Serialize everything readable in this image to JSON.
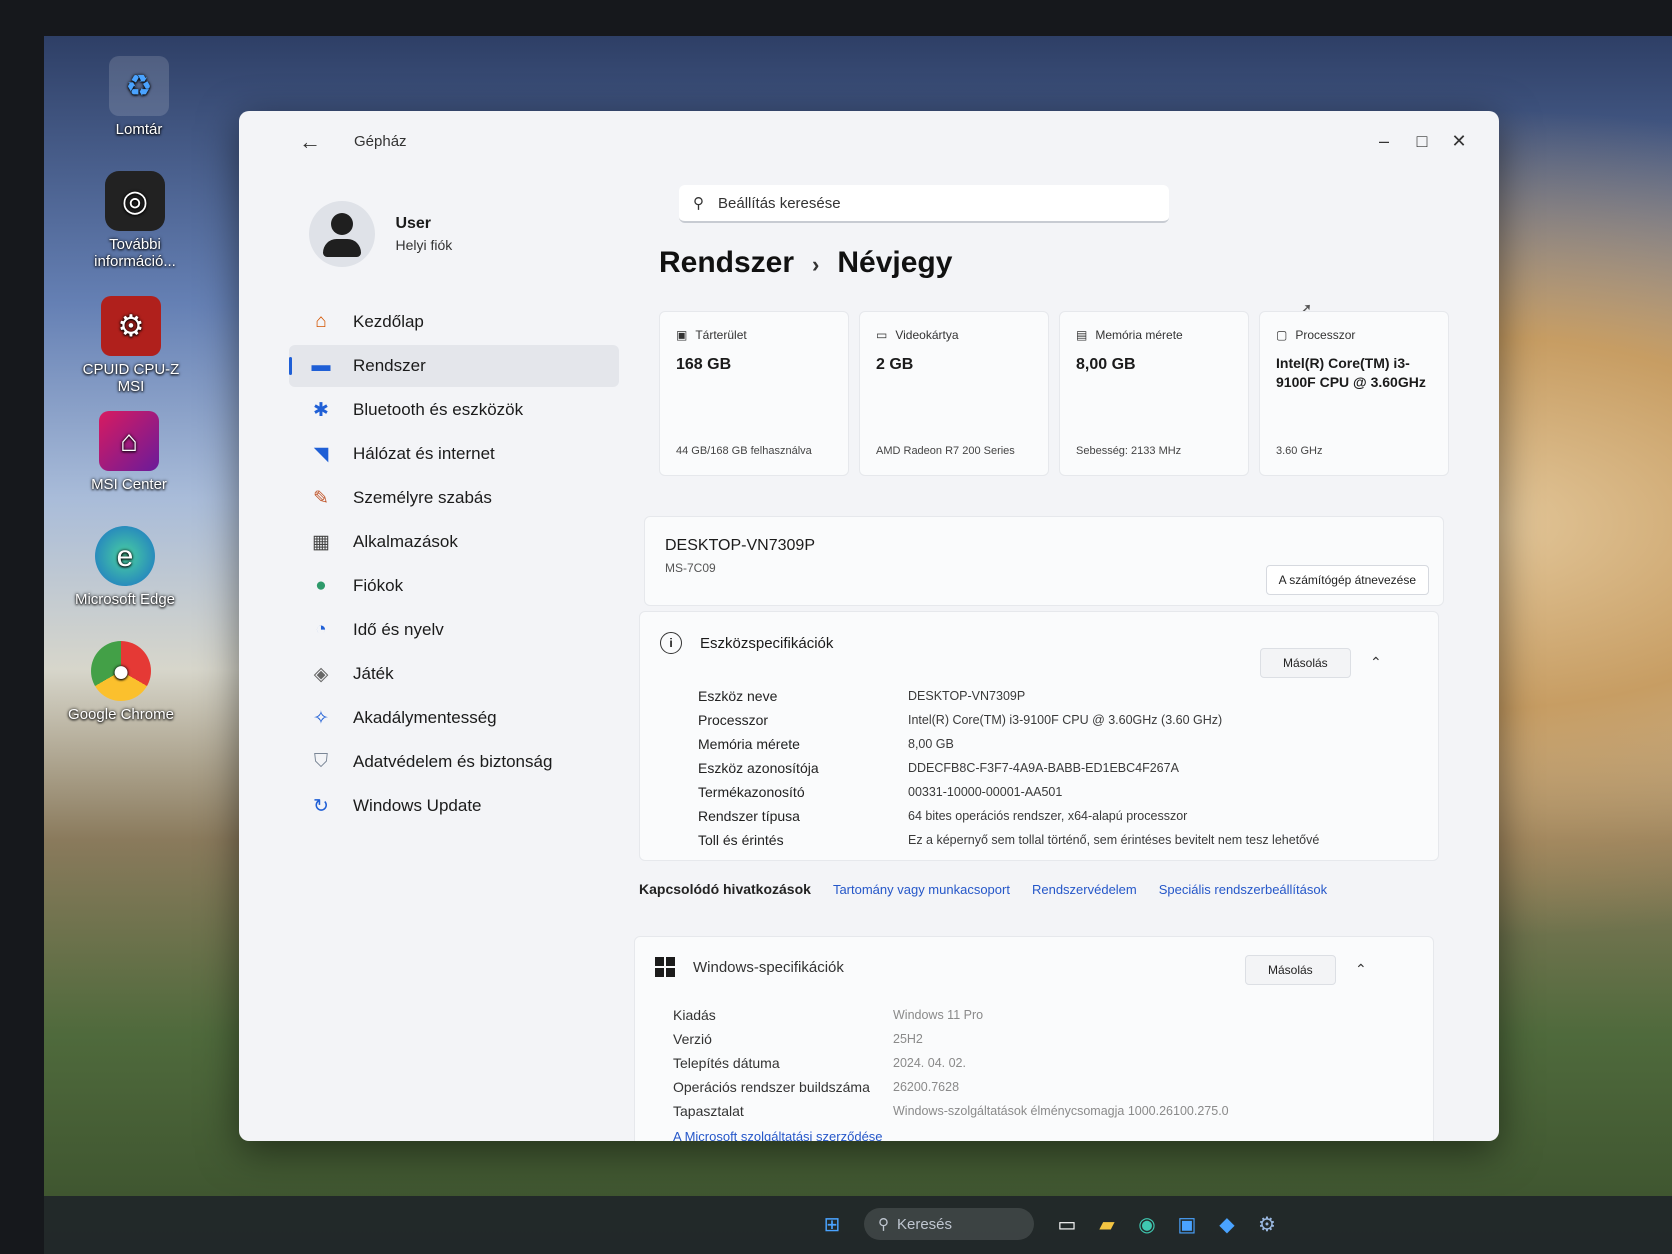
{
  "desktop": {
    "icons": [
      {
        "label": "Lomtár",
        "icon": "recycle-bin-icon"
      },
      {
        "label": "További információ...",
        "icon": "camera-info-icon"
      },
      {
        "label": "CPUID CPU-Z MSI",
        "icon": "cpuz-icon"
      },
      {
        "label": "MSI Center",
        "icon": "msi-center-icon"
      },
      {
        "label": "Microsoft Edge",
        "icon": "edge-icon"
      },
      {
        "label": "Google Chrome",
        "icon": "chrome-icon"
      }
    ]
  },
  "taskbar": {
    "search_placeholder": "Keresés"
  },
  "window": {
    "title": "Gépház",
    "search_placeholder": "Beállítás keresése",
    "user": {
      "name": "User",
      "account": "Helyi fiók"
    },
    "breadcrumb": {
      "parent": "Rendszer",
      "separator": "›",
      "current": "Névjegy"
    },
    "nav": [
      {
        "label": "Kezdőlap",
        "icon": "home-icon",
        "active": false
      },
      {
        "label": "Rendszer",
        "icon": "system-icon",
        "active": true
      },
      {
        "label": "Bluetooth és eszközök",
        "icon": "bluetooth-icon",
        "active": false
      },
      {
        "label": "Hálózat és internet",
        "icon": "wifi-icon",
        "active": false
      },
      {
        "label": "Személyre szabás",
        "icon": "brush-icon",
        "active": false
      },
      {
        "label": "Alkalmazások",
        "icon": "apps-icon",
        "active": false
      },
      {
        "label": "Fiókok",
        "icon": "account-icon",
        "active": false
      },
      {
        "label": "Idő és nyelv",
        "icon": "time-language-icon",
        "active": false
      },
      {
        "label": "Játék",
        "icon": "gamepad-icon",
        "active": false
      },
      {
        "label": "Akadálymentesség",
        "icon": "accessibility-icon",
        "active": false
      },
      {
        "label": "Adatvédelem és biztonság",
        "icon": "shield-icon",
        "active": false
      },
      {
        "label": "Windows Update",
        "icon": "update-icon",
        "active": false
      }
    ],
    "cards": {
      "storage": {
        "title": "Tárterület",
        "value": "168 GB",
        "sub": "44 GB/168 GB felhasználva"
      },
      "gpu": {
        "title": "Videokártya",
        "value": "2 GB",
        "sub": "AMD Radeon R7 200 Series"
      },
      "memory": {
        "title": "Memória mérete",
        "value": "8,00 GB",
        "sub": "Sebesség: 2133 MHz"
      },
      "cpu": {
        "title": "Processzor",
        "value": "Intel(R) Core(TM) i3-9100F CPU @ 3.60GHz",
        "sub": "3.60 GHz"
      }
    },
    "device": {
      "name": "DESKTOP-VN7309P",
      "model": "MS-7C09",
      "rename_label": "A számítógép átnevezése"
    },
    "device_specs": {
      "title": "Eszközspecifikációk",
      "copy_label": "Másolás",
      "rows": [
        {
          "key": "Eszköz neve",
          "value": "DESKTOP-VN7309P"
        },
        {
          "key": "Processzor",
          "value": "Intel(R) Core(TM) i3-9100F CPU @ 3.60GHz (3.60 GHz)"
        },
        {
          "key": "Memória mérete",
          "value": "8,00 GB"
        },
        {
          "key": "Eszköz azonosítója",
          "value": "DDECFB8C-F3F7-4A9A-BABB-ED1EBC4F267A"
        },
        {
          "key": "Termékazonosító",
          "value": "00331-10000-00001-AA501"
        },
        {
          "key": "Rendszer típusa",
          "value": "64 bites operációs rendszer, x64-alapú processzor"
        },
        {
          "key": "Toll és érintés",
          "value": "Ez a képernyő sem tollal történő, sem érintéses bevitelt nem tesz lehetővé"
        }
      ]
    },
    "related_links": {
      "label": "Kapcsolódó hivatkozások",
      "links": [
        "Tartomány vagy munkacsoport",
        "Rendszervédelem",
        "Speciális rendszerbeállítások"
      ]
    },
    "windows_specs": {
      "title": "Windows-specifikációk",
      "copy_label": "Másolás",
      "rows": [
        {
          "key": "Kiadás",
          "value": "Windows 11 Pro"
        },
        {
          "key": "Verzió",
          "value": "25H2"
        },
        {
          "key": "Telepítés dátuma",
          "value": "2024. 04. 02."
        },
        {
          "key": "Operációs rendszer buildszáma",
          "value": "26200.7628"
        },
        {
          "key": "Tapasztalat",
          "value": "Windows-szolgáltatások élménycsomagja 1000.26100.275.0"
        }
      ],
      "ms_link": "A Microsoft szolgáltatási szerződése"
    }
  }
}
